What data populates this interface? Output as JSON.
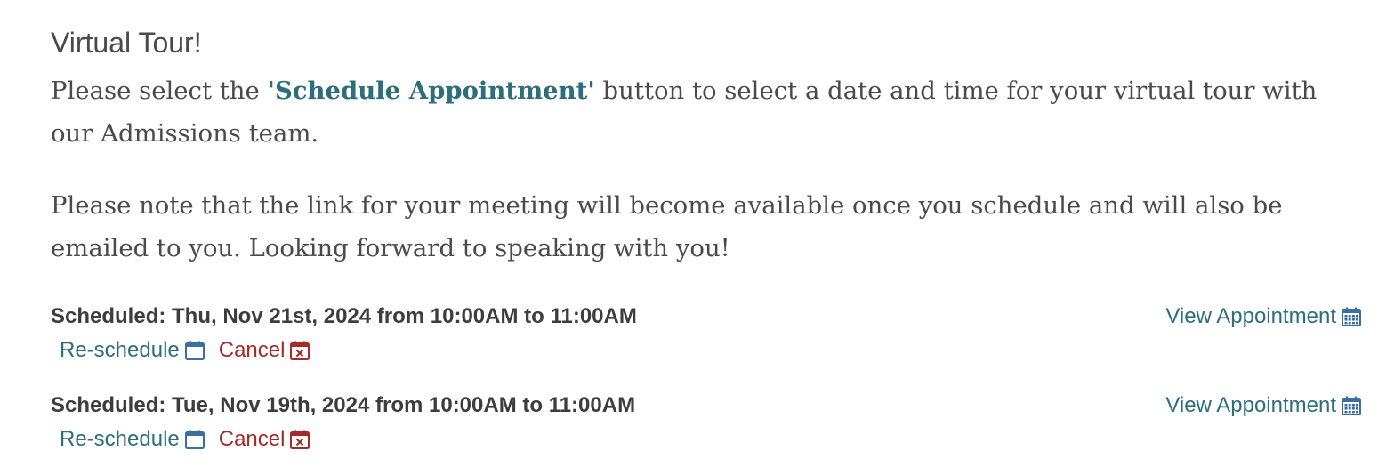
{
  "heading": "Virtual Tour!",
  "intro": {
    "prefix": "Please select the ",
    "highlight": "'Schedule Appointment'",
    "suffix": " button to select a date and time for your virtual tour with our Admissions team."
  },
  "note": "Please note that the link for your meeting will become available once you schedule and will also be emailed to you. Looking forward to speaking with you!",
  "appointments": [
    {
      "scheduled_text": "Scheduled: Thu, Nov 21st, 2024 from 10:00AM to 11:00AM",
      "view_label": "View Appointment",
      "reschedule_label": "Re-schedule",
      "cancel_label": "Cancel"
    },
    {
      "scheduled_text": "Scheduled: Tue, Nov 19th, 2024 from 10:00AM to 11:00AM",
      "view_label": "View Appointment",
      "reschedule_label": "Re-schedule",
      "cancel_label": "Cancel"
    }
  ],
  "colors": {
    "link": "#2c6e7c",
    "cancel": "#a52a2a",
    "text": "#4a4a4a",
    "icon_blue": "#3a6ea5"
  },
  "icons": {
    "view": "calendar-grid-icon",
    "reschedule": "calendar-icon",
    "cancel": "calendar-x-icon"
  }
}
